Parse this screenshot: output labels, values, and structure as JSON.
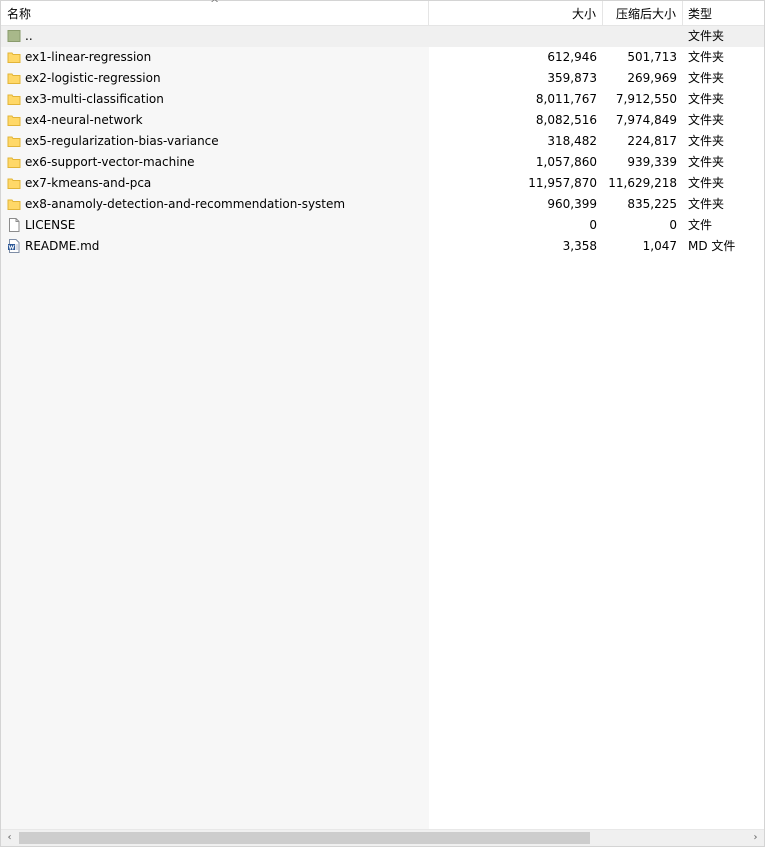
{
  "columns": {
    "name": "名称",
    "size": "大小",
    "packed": "压缩后大小",
    "type": "类型"
  },
  "rows": [
    {
      "name": "..",
      "size": "",
      "packed": "",
      "type": "文件夹",
      "icon": "parent-folder-icon"
    },
    {
      "name": "ex1-linear-regression",
      "size": "612,946",
      "packed": "501,713",
      "type": "文件夹",
      "icon": "folder-icon"
    },
    {
      "name": "ex2-logistic-regression",
      "size": "359,873",
      "packed": "269,969",
      "type": "文件夹",
      "icon": "folder-icon"
    },
    {
      "name": "ex3-multi-classification",
      "size": "8,011,767",
      "packed": "7,912,550",
      "type": "文件夹",
      "icon": "folder-icon"
    },
    {
      "name": "ex4-neural-network",
      "size": "8,082,516",
      "packed": "7,974,849",
      "type": "文件夹",
      "icon": "folder-icon"
    },
    {
      "name": "ex5-regularization-bias-variance",
      "size": "318,482",
      "packed": "224,817",
      "type": "文件夹",
      "icon": "folder-icon"
    },
    {
      "name": "ex6-support-vector-machine",
      "size": "1,057,860",
      "packed": "939,339",
      "type": "文件夹",
      "icon": "folder-icon"
    },
    {
      "name": "ex7-kmeans-and-pca",
      "size": "11,957,870",
      "packed": "11,629,218",
      "type": "文件夹",
      "icon": "folder-icon"
    },
    {
      "name": "ex8-anamoly-detection-and-recommendation-system",
      "size": "960,399",
      "packed": "835,225",
      "type": "文件夹",
      "icon": "folder-icon"
    },
    {
      "name": "LICENSE",
      "size": "0",
      "packed": "0",
      "type": "文件",
      "icon": "file-icon"
    },
    {
      "name": "README.md",
      "size": "3,358",
      "packed": "1,047",
      "type": "MD 文件",
      "icon": "document-icon"
    }
  ],
  "scrollbar": {
    "left_arrow": "‹",
    "right_arrow": "›"
  },
  "sort_indicator": "^",
  "colors": {
    "folder": "#ffd868",
    "folder_edge": "#e2b437",
    "parent_folder": "#a8b88a"
  }
}
